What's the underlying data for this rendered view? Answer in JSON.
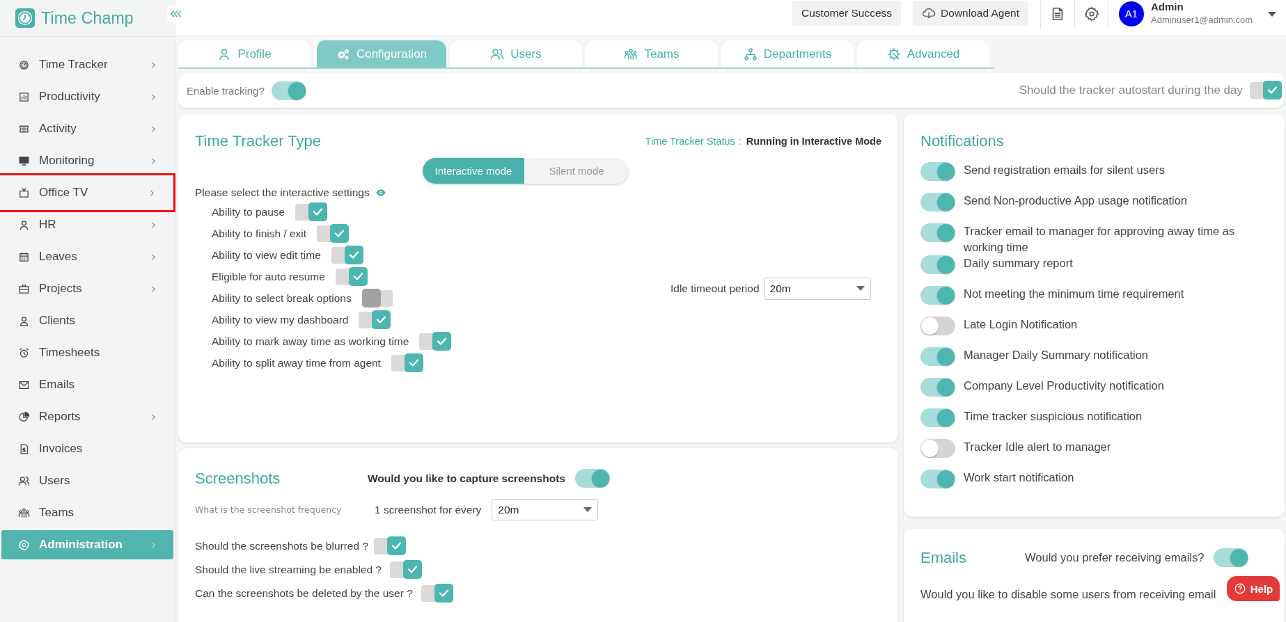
{
  "sidebar": {
    "logo": "Time Champ",
    "items": [
      {
        "label": "Time Tracker",
        "has_submenu": true,
        "selected": false,
        "highlighted": false
      },
      {
        "label": "Productivity",
        "has_submenu": true,
        "selected": false,
        "highlighted": false
      },
      {
        "label": "Activity",
        "has_submenu": true,
        "selected": false,
        "highlighted": false
      },
      {
        "label": "Monitoring",
        "has_submenu": true,
        "selected": false,
        "highlighted": false
      },
      {
        "label": "Office TV",
        "has_submenu": true,
        "selected": false,
        "highlighted": true
      },
      {
        "label": "HR",
        "has_submenu": true,
        "selected": false,
        "highlighted": false
      },
      {
        "label": "Leaves",
        "has_submenu": true,
        "selected": false,
        "highlighted": false
      },
      {
        "label": "Projects",
        "has_submenu": true,
        "selected": false,
        "highlighted": false
      },
      {
        "label": "Clients",
        "has_submenu": false,
        "selected": false,
        "highlighted": false
      },
      {
        "label": "Timesheets",
        "has_submenu": false,
        "selected": false,
        "highlighted": false
      },
      {
        "label": "Emails",
        "has_submenu": false,
        "selected": false,
        "highlighted": false
      },
      {
        "label": "Reports",
        "has_submenu": true,
        "selected": false,
        "highlighted": false
      },
      {
        "label": "Invoices",
        "has_submenu": false,
        "selected": false,
        "highlighted": false
      },
      {
        "label": "Users",
        "has_submenu": false,
        "selected": false,
        "highlighted": false
      },
      {
        "label": "Teams",
        "has_submenu": false,
        "selected": false,
        "highlighted": false
      },
      {
        "label": "Administration",
        "has_submenu": true,
        "selected": true,
        "highlighted": false
      }
    ]
  },
  "top_bar": {
    "buttons": [
      {
        "label": "Customer Success",
        "kind": "text"
      },
      {
        "label": "Download Agent",
        "kind": "download"
      }
    ],
    "user": {
      "initials": "A1",
      "name": "Admin",
      "email": "Adminuser1@admin.com"
    }
  },
  "tabs": [
    {
      "label": "Profile",
      "selected": false
    },
    {
      "label": "Configuration",
      "selected": true
    },
    {
      "label": "Users",
      "selected": false
    },
    {
      "label": "Teams",
      "selected": false
    },
    {
      "label": "Departments",
      "selected": false
    },
    {
      "label": "Advanced",
      "selected": false
    }
  ],
  "tracking": {
    "enable": {
      "label": "Enable tracking?",
      "kind": "switch",
      "on": true
    },
    "autostart": {
      "label": "Should the tracker autostart during the day",
      "kind": "check",
      "on": true
    }
  },
  "tracker_type": {
    "title": "Time Tracker Type",
    "status_label": "Time Tracker Status :",
    "status_value": "Running in Interactive Mode",
    "modes": [
      {
        "label": "Interactive mode",
        "selected": true
      },
      {
        "label": "Silent mode",
        "selected": false
      }
    ],
    "settings_heading": "Please select the interactive settings",
    "settings": [
      {
        "label": "Ability to pause",
        "on": true
      },
      {
        "label": "Ability to finish / exit",
        "on": true
      },
      {
        "label": "Ability to view edit time",
        "on": true
      },
      {
        "label": "Eligible for auto resume",
        "on": true
      },
      {
        "label": "Ability to select break options",
        "on": false
      },
      {
        "label": "Ability to view my dashboard",
        "on": true
      },
      {
        "label": "Ability to mark away time as working time",
        "on": true
      },
      {
        "label": "Ability to split away time from agent",
        "on": true
      }
    ],
    "idle_timeout": {
      "label": "Idle timeout period",
      "value": "20m"
    }
  },
  "screenshots": {
    "title": "Screenshots",
    "capture": {
      "label": "Would you like to capture screenshots",
      "on": true
    },
    "frequency_label": "What is the screenshot frequency",
    "frequency_prefix": "1 screenshot for every",
    "frequency_value": "20m",
    "options": [
      {
        "label": "Should the screenshots be blurred ?",
        "on": true
      },
      {
        "label": "Should the live streaming be enabled ?",
        "on": true
      },
      {
        "label": "Can the screenshots be deleted by the user ?",
        "on": true
      }
    ]
  },
  "notifications": {
    "title": "Notifications",
    "items": [
      {
        "label": "Send registration emails for silent users",
        "on": true
      },
      {
        "label": "Send Non-productive App usage notification",
        "on": true
      },
      {
        "label": "Tracker email to manager for approving away time as working time",
        "on": true
      },
      {
        "label": "Daily summary report",
        "on": true
      },
      {
        "label": "Not meeting the minimum time requirement",
        "on": true
      },
      {
        "label": "Late Login Notification",
        "on": false
      },
      {
        "label": "Manager Daily Summary notification",
        "on": true
      },
      {
        "label": "Company Level Productivity notification",
        "on": true
      },
      {
        "label": "Time tracker suspicious notification",
        "on": true
      },
      {
        "label": "Tracker Idle alert to manager",
        "on": false
      },
      {
        "label": "Work start notification",
        "on": true
      }
    ]
  },
  "emails": {
    "title": "Emails",
    "prefer": {
      "label": "Would you prefer receiving emails?",
      "on": true
    },
    "disable_label": "Would you like to disable some users from receiving email"
  },
  "help": "Help"
}
